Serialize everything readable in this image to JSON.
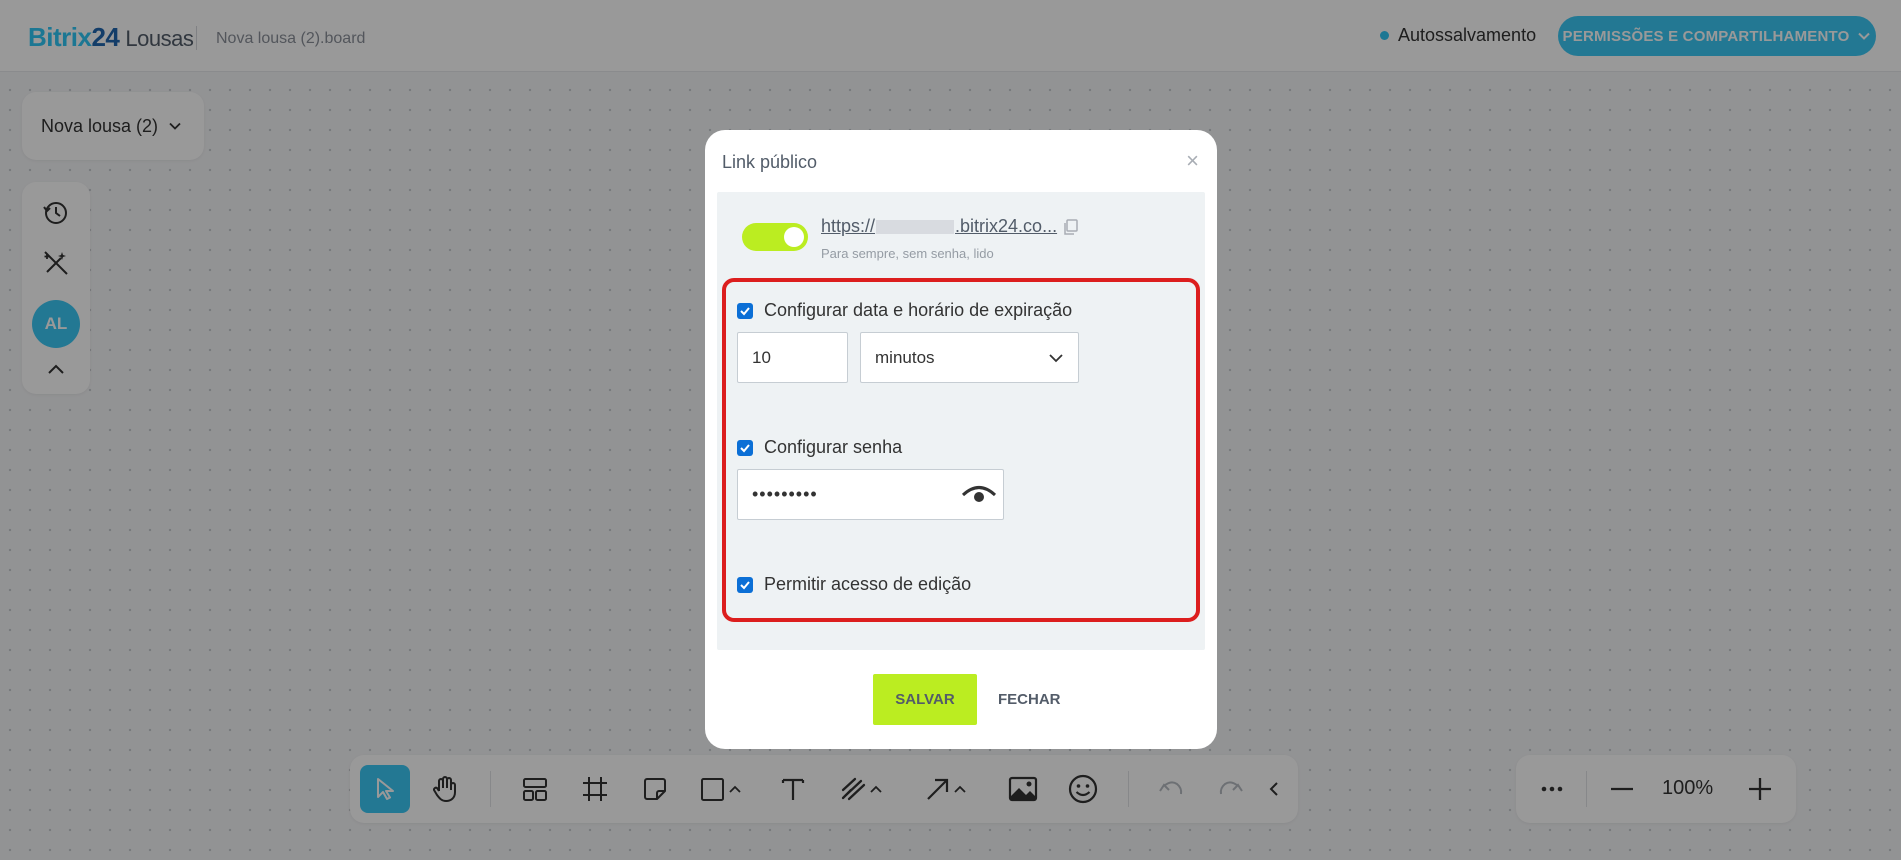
{
  "header": {
    "logo_brand": "Bitrix",
    "logo_number": "24",
    "logo_product": "Lousas",
    "file_name": "Nova lousa (2).board",
    "autosave_label": "Autossalvamento",
    "share_button_label": "PERMISSÕES E COMPARTILHAMENTO"
  },
  "board": {
    "name_chip": "Nova lousa (2)"
  },
  "left_toolbar": {
    "avatar_initials": "AL"
  },
  "zoom": {
    "value": "100%"
  },
  "dialog": {
    "title": "Link público",
    "close_glyph": "×",
    "link_prefix": "https://",
    "link_suffix": ".bitrix24.co...",
    "link_subtitle": "Para sempre, sem senha, lido",
    "expiration_label": "Configurar data e horário de expiração",
    "expiration_value": "10",
    "expiration_unit": "minutos",
    "password_label": "Configurar senha",
    "password_value": "•••••••••",
    "edit_access_label": "Permitir acesso de edição",
    "save_label": "SALVAR",
    "close_label": "FECHAR"
  },
  "colors": {
    "accent_blue": "#3bc8f5",
    "accent_green": "#bbed21",
    "highlight_red": "#dc1e1e",
    "checkbox_blue": "#0b6fd6"
  },
  "icons": [
    "history-icon",
    "magic-off-icon",
    "chevron-up-icon",
    "pointer-icon",
    "hand-icon",
    "layout-icon",
    "frame-icon",
    "sticky-note-icon",
    "shape-icon",
    "text-icon",
    "pen-icon",
    "arrow-icon",
    "image-icon",
    "emoji-icon",
    "undo-icon",
    "redo-icon",
    "collapse-icon",
    "more-icon",
    "zoom-out-icon",
    "zoom-in-icon",
    "copy-icon",
    "eye-icon"
  ]
}
